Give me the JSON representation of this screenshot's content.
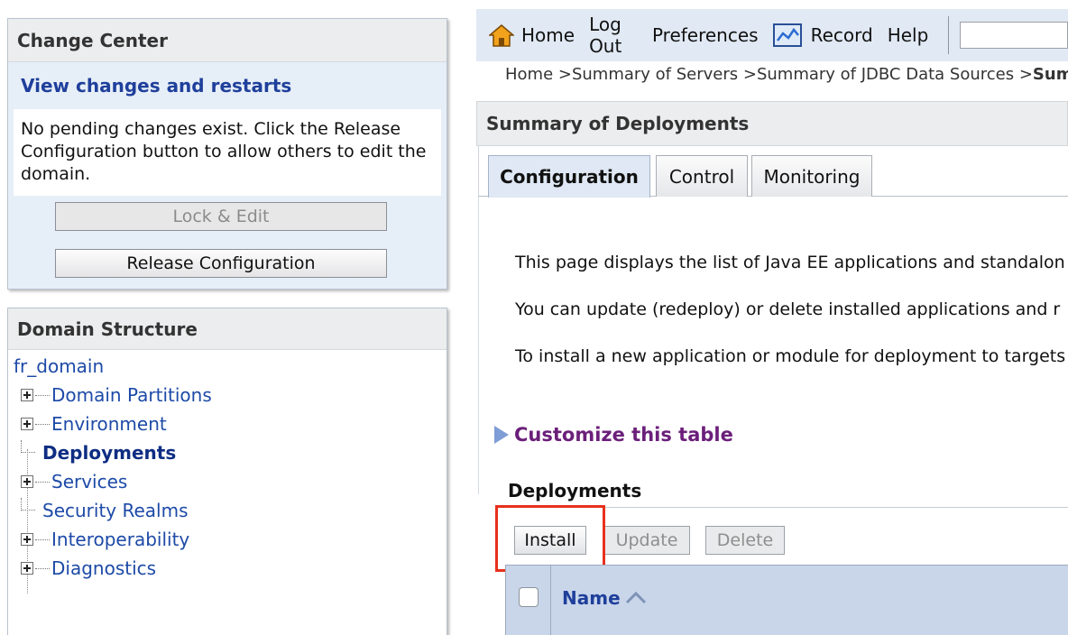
{
  "change_center": {
    "title": "Change Center",
    "view_changes_link": "View changes and restarts",
    "message": "No pending changes exist. Click the Release Configuration button to allow others to edit the domain.",
    "lock_edit_label": "Lock & Edit",
    "release_config_label": "Release Configuration"
  },
  "domain_structure": {
    "title": "Domain Structure",
    "root": "fr_domain",
    "items": [
      {
        "label": "Domain Partitions",
        "expandable": true
      },
      {
        "label": "Environment",
        "expandable": true
      },
      {
        "label": "Deployments",
        "expandable": false,
        "selected": true
      },
      {
        "label": "Services",
        "expandable": true
      },
      {
        "label": "Security Realms",
        "expandable": false
      },
      {
        "label": "Interoperability",
        "expandable": true
      },
      {
        "label": "Diagnostics",
        "expandable": true
      }
    ]
  },
  "topnav": {
    "home": "Home",
    "logout": "Log Out",
    "preferences": "Preferences",
    "record": "Record",
    "help": "Help",
    "search_value": ""
  },
  "breadcrumb": {
    "path": "Home >Summary of Servers >Summary of JDBC Data Sources >",
    "current": "Summ"
  },
  "summary": {
    "title": "Summary of Deployments",
    "tabs": [
      "Configuration",
      "Control",
      "Monitoring"
    ],
    "active_tab": "Configuration",
    "description": [
      "This page displays the list of Java EE applications and standalon",
      "You can update (redeploy) or delete installed applications and r",
      "To install a new application or module for deployment to targets"
    ],
    "customize_link": "Customize this table"
  },
  "deployments_table": {
    "title": "Deployments",
    "buttons": {
      "install": "Install",
      "update": "Update",
      "delete": "Delete"
    },
    "columns": [
      "Name"
    ]
  },
  "colors": {
    "highlight": "#e8301c",
    "link_blue": "#1d4aa7",
    "customize_purple": "#6b1f7a",
    "table_header_bg": "#c9d6ea"
  }
}
